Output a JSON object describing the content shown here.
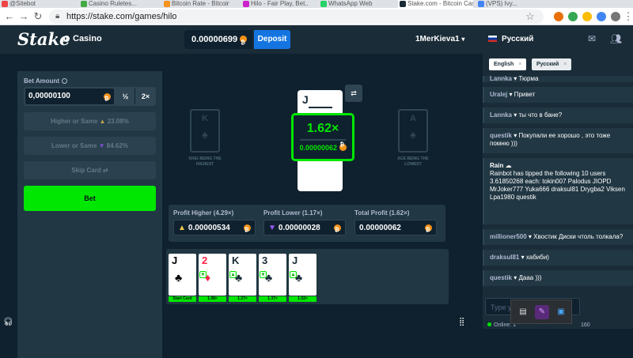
{
  "browser": {
    "tabs": [
      {
        "label": "@Sitebot"
      },
      {
        "label": "Casino Ruletes..."
      },
      {
        "label": "Bitcoin Rate - Bitcoin..."
      },
      {
        "label": "Hilo - Fair Play, Bet..."
      },
      {
        "label": "WhatsApp Web"
      },
      {
        "label": "Stake.com - Bitcoin Casi..."
      },
      {
        "label": "(VPS) Ivy..."
      }
    ],
    "url": "https://stake.com/games/hilo"
  },
  "header": {
    "logo": "Stake",
    "casino_label": "Casino",
    "balance": "0.00000699",
    "deposit_label": "Deposit",
    "username": "1MerKieva1",
    "language": "Русский"
  },
  "controls": {
    "bet_amount_label": "Bet Amount",
    "bet_amount_value": "0,00000100",
    "half_label": "½",
    "double_label": "2×",
    "higher_label": "Higher or Same",
    "higher_chance": "23.08%",
    "lower_label": "Lower or Same",
    "lower_chance": "84.62%",
    "skip_label": "Skip Card",
    "bet_label": "Bet"
  },
  "board": {
    "ghost_left_rank": "K",
    "ghost_left_text": "KING BEING THE HIGHEST",
    "ghost_right_rank": "A",
    "ghost_right_text": "ACE BEING THE LOWEST",
    "current_card": "J",
    "payout_multiplier": "1.62×",
    "payout_amount": "0.00000062",
    "profit_higher_label": "Profit Higher (4.29×)",
    "profit_higher_value": "0.00000534",
    "profit_lower_label": "Profit Lower (1.17×)",
    "profit_lower_value": "0.00000028",
    "total_profit_label": "Total Profit (1.62×)",
    "total_profit_value": "0.00000062"
  },
  "history": [
    {
      "rank": "J",
      "suit": "♣",
      "color": "black",
      "guess": "",
      "tag": "Start Card"
    },
    {
      "rank": "2",
      "suit": "♦",
      "color": "red",
      "guess": "▼",
      "tag": "1.08×"
    },
    {
      "rank": "K",
      "suit": "♣",
      "color": "black",
      "guess": "▲",
      "tag": "1.27×"
    },
    {
      "rank": "3",
      "suit": "♣",
      "color": "black",
      "guess": "▼",
      "tag": "1.37×"
    },
    {
      "rank": "J",
      "suit": "♣",
      "color": "black",
      "guess": "▲",
      "tag": "1.62×"
    }
  ],
  "chat": {
    "lang_chips": [
      {
        "label": "English"
      },
      {
        "label": "Русский"
      }
    ],
    "messages": [
      {
        "user": "Lannka",
        "text": "Тюрма"
      },
      {
        "user": "Uralej",
        "text": "Привет"
      },
      {
        "user": "Lannka",
        "text": "ты что в бане?"
      },
      {
        "user": "questik",
        "text": "Покупали ее хорошо , это тоже помню )))"
      },
      {
        "user": "Rain",
        "text": "Rainbot has tipped the following 10 users 3.61850268 each: tokin007 Palodus JIOPD MrJoker777 Yuka666 draksul81 Drygba2 Viksen Lpa1980 questik"
      },
      {
        "user": "millioner500",
        "text": "Хвостик Диски чтоль толкала?"
      },
      {
        "user": "draksul81",
        "text": "хабиби)"
      },
      {
        "user": "questik",
        "text": "Дааа )))"
      }
    ],
    "input_placeholder": "Type your message",
    "online_label": "Online: 1",
    "count": "160"
  },
  "colors": {
    "accent": "#00e701",
    "deposit": "#1475e1",
    "bg": "#0f212e",
    "panel": "#213743"
  }
}
